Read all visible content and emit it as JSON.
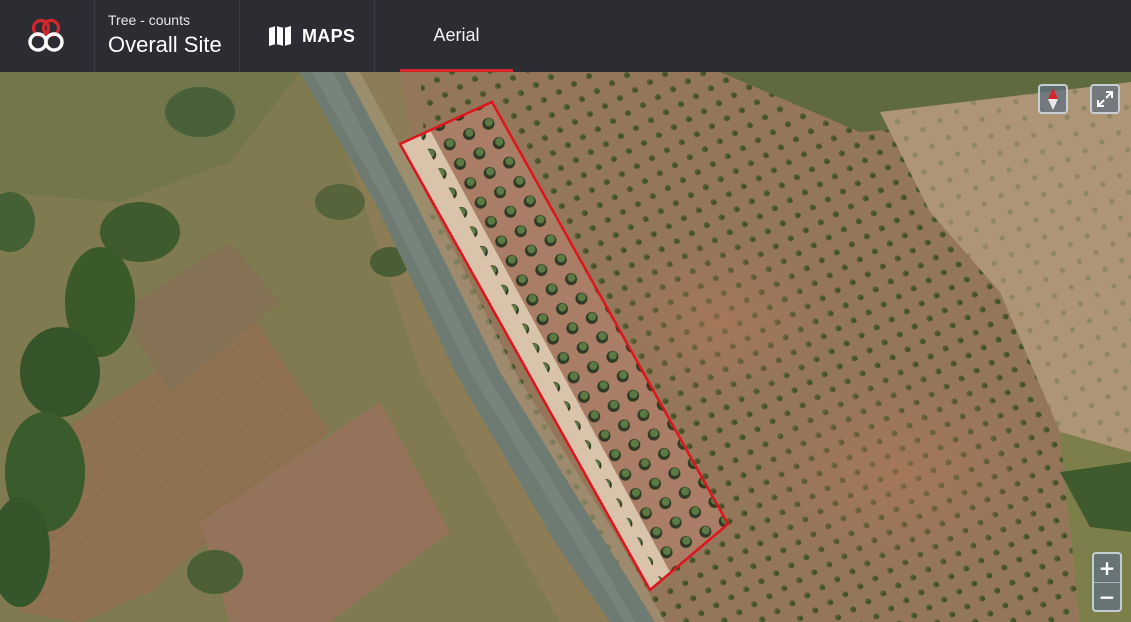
{
  "header": {
    "subtitle": "Tree - counts",
    "title": "Overall Site",
    "maps_label": "MAPS",
    "tabs": [
      {
        "label": "Aerial",
        "active": true
      }
    ]
  },
  "colors": {
    "topbar": "#2b2d33",
    "accent": "#d6262c",
    "polygon_outline": "#e0141c",
    "map_control": "#607080"
  },
  "icons": {
    "logo": "overlapping-rings-logo",
    "maps": "folded-map-icon",
    "compass": "compass-needle-icon",
    "fullscreen": "expand-arrows-icon"
  },
  "map": {
    "layer": "Aerial",
    "zoom_in_label": "+",
    "zoom_out_label": "−"
  }
}
